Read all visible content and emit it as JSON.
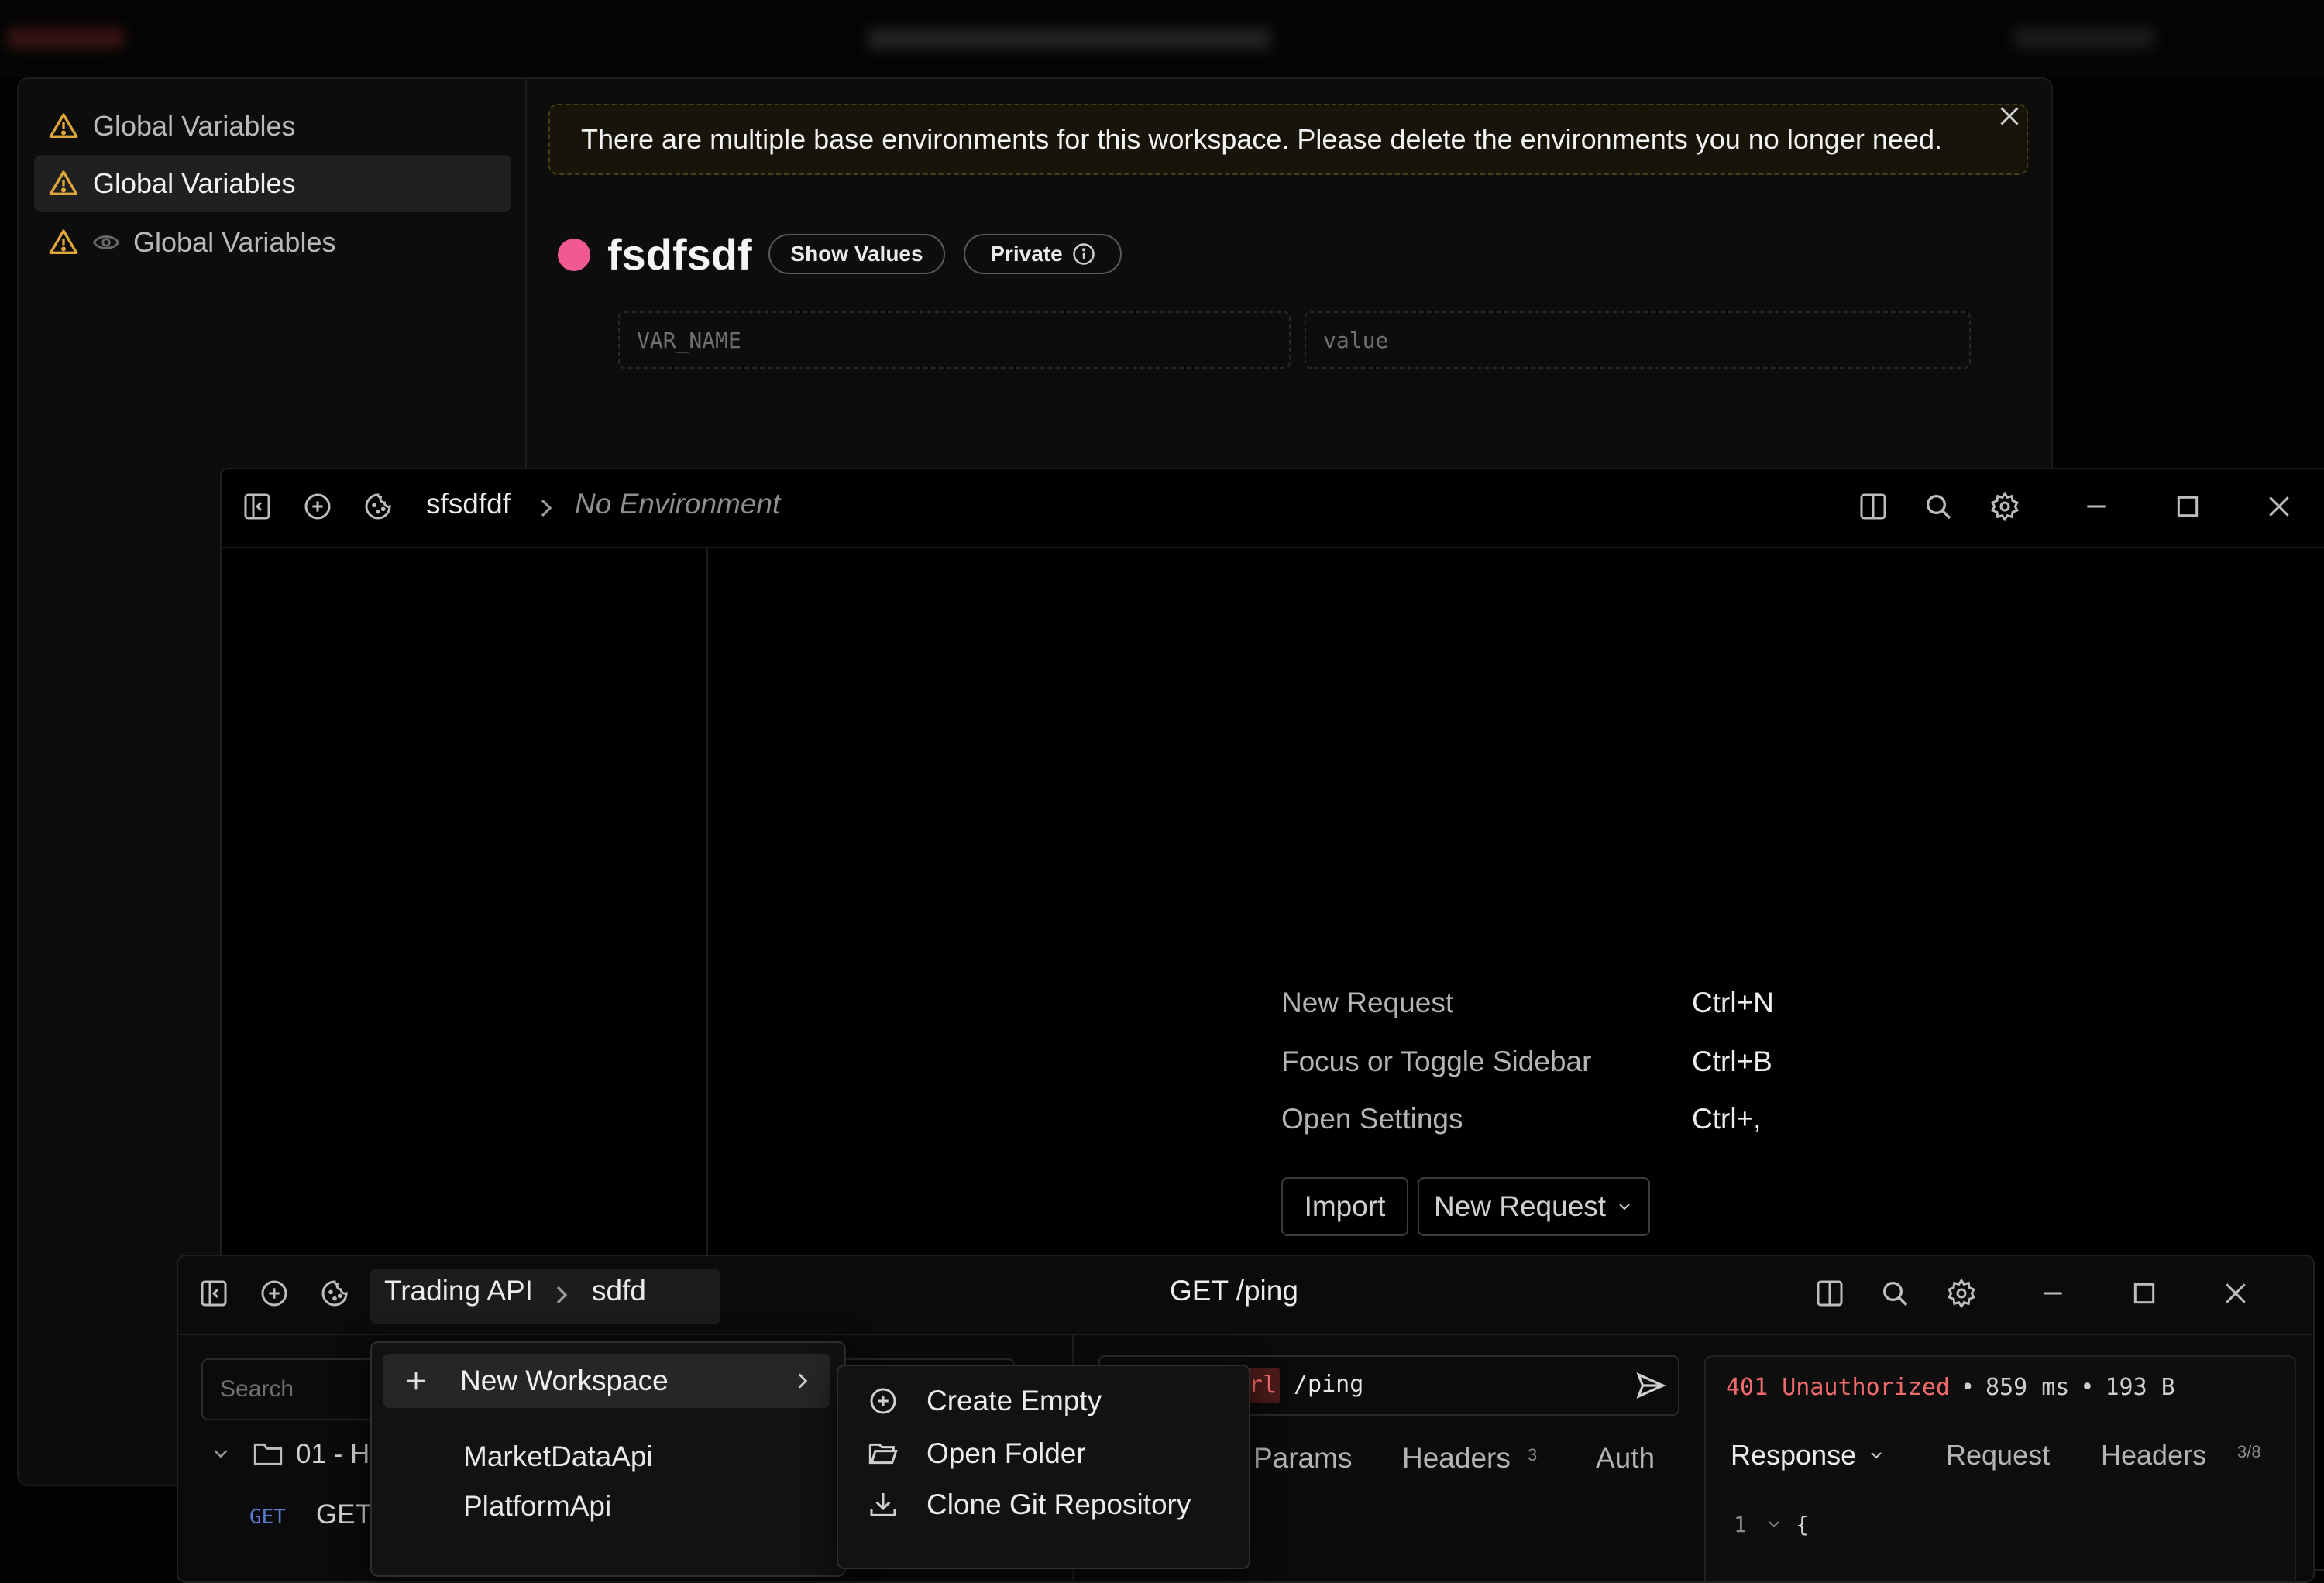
{
  "env_window": {
    "sidebar_items": [
      {
        "label": "Global Variables"
      },
      {
        "label": "Global Variables"
      },
      {
        "label": "Global Variables"
      }
    ],
    "banner_text": "There are multiple base environments for this workspace. Please delete the environments you no longer need.",
    "environment_name": "fsdfsdf",
    "environment_color": "#f05a90",
    "show_values_label": "Show Values",
    "private_label": "Private",
    "var_name_placeholder": "VAR_NAME",
    "value_placeholder": "value"
  },
  "mid_window": {
    "workspace": "sfsdfdf",
    "environment": "No Environment",
    "shortcuts": [
      {
        "label": "New Request",
        "key": "Ctrl+N"
      },
      {
        "label": "Focus or Toggle Sidebar",
        "key": "Ctrl+B"
      },
      {
        "label": "Open Settings",
        "key": "Ctrl+,"
      }
    ],
    "import_label": "Import",
    "new_request_label": "New Request"
  },
  "bot_window": {
    "workspace": "Trading API",
    "environment": "sdfd",
    "title": "GET /ping",
    "search_placeholder": "Search",
    "tree_folder": "01 - H",
    "tree_method": "GET",
    "tree_request": "GET",
    "url_var": "url",
    "url_path": "/ping",
    "tabs": {
      "params": "Params",
      "headers": "Headers",
      "headers_count": "3",
      "auth": "Auth"
    },
    "response": {
      "status": "401 Unauthorized",
      "time": "859 ms",
      "size": "193 B",
      "separator": "•",
      "tab_response": "Response",
      "tab_request": "Request",
      "tab_headers": "Headers",
      "headers_count": "3/8",
      "line_number": "1",
      "line_text": "{"
    }
  },
  "menu": {
    "new_workspace": "New Workspace",
    "workspaces": [
      "MarketDataApi",
      "PlatformApi"
    ],
    "submenu": [
      "Create Empty",
      "Open Folder",
      "Clone Git Repository"
    ]
  },
  "colors": {
    "warning": "#e0a83a",
    "status_error": "#f26b6b",
    "url_var_bg": "#4a1a1a"
  }
}
